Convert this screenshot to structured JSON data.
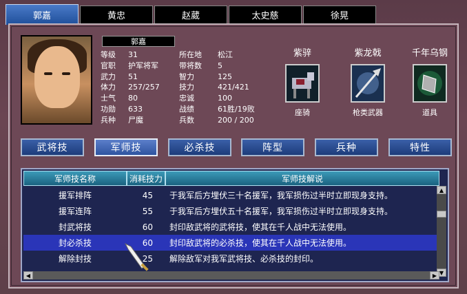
{
  "tabs": [
    "郭嘉",
    "黄忠",
    "赵葳",
    "太史慈",
    "徐晃"
  ],
  "active_tab": 0,
  "general": {
    "name": "郭嘉",
    "stats": [
      {
        "k1": "等级",
        "v1": "31",
        "k2": "所在地",
        "v2": "松江"
      },
      {
        "k1": "官职",
        "v1": "护军将军",
        "k2": "带将数",
        "v2": "5"
      },
      {
        "k1": "武力",
        "v1": "51",
        "k2": "智力",
        "v2": "125"
      },
      {
        "k1": "体力",
        "v1": "257/257",
        "k2": "技力",
        "v2": "421/421"
      },
      {
        "k1": "士气",
        "v1": "80",
        "k2": "忠诚",
        "v2": "100"
      },
      {
        "k1": "功勋",
        "v1": "633",
        "k2": "战绩",
        "v2": "61胜/19败"
      },
      {
        "k1": "兵种",
        "v1": "尸魔",
        "k2": "兵数",
        "v2": "200 / 200"
      }
    ]
  },
  "equipment": [
    {
      "name": "紫骍",
      "type": "座骑",
      "icon": "horse-icon"
    },
    {
      "name": "紫龙戟",
      "type": "枪类武器",
      "icon": "halberd-icon"
    },
    {
      "name": "千年乌钢",
      "type": "道具",
      "icon": "steel-icon"
    }
  ],
  "skill_buttons": [
    "武将技",
    "军师技",
    "必杀技",
    "阵型",
    "兵种",
    "特性"
  ],
  "active_button": 1,
  "table": {
    "headers": [
      "军师技名称",
      "消耗技力",
      "军师技解说"
    ],
    "rows": [
      {
        "name": "援军排阵",
        "cost": "45",
        "desc": "于我军后方埋伏三十名援军，我军损伤过半时立即现身支持。"
      },
      {
        "name": "援军连阵",
        "cost": "55",
        "desc": "于我军后方埋伏五十名援军，我军损伤过半时立即现身支持。"
      },
      {
        "name": "封武将技",
        "cost": "60",
        "desc": "封印敌武将的武将技，使其在千人战中无法使用。"
      },
      {
        "name": "封必杀技",
        "cost": "60",
        "desc": "封印敌武将的必杀技，使其在千人战中无法使用。"
      },
      {
        "name": "解除封技",
        "cost": "25",
        "desc": "解除敌军对我军武将技、必杀技的封印。"
      }
    ],
    "selected_row": 3
  },
  "colors": {
    "tab_active": "#2e5aa8",
    "row_selected": "#2a35b8",
    "table_bg": "#1e2550"
  }
}
